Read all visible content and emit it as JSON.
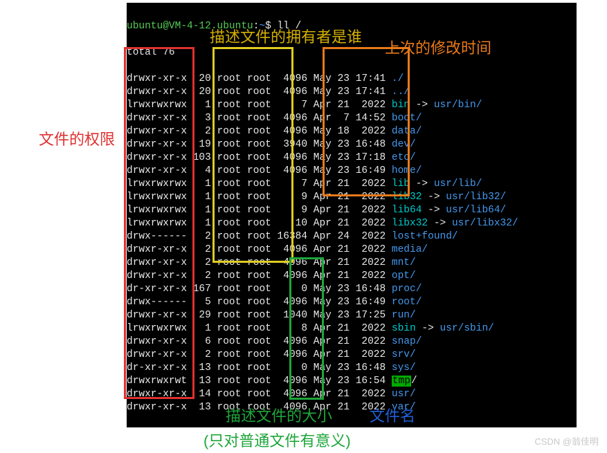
{
  "prompt": {
    "user": "ubuntu@VM-4-12.ubuntu",
    "sep": ":",
    "path": "~",
    "dollar": "$",
    "cmd": "ll /"
  },
  "total_line": "total 76",
  "rows": [
    {
      "perm": "drwxr-xr-x",
      "links": "20",
      "owner": "root",
      "group": "root",
      "size": "4096",
      "date": "May 23 17:41",
      "name": "./",
      "type": "dir"
    },
    {
      "perm": "drwxr-xr-x",
      "links": "20",
      "owner": "root",
      "group": "root",
      "size": "4096",
      "date": "May 23 17:41",
      "name": "../",
      "type": "dir"
    },
    {
      "perm": "lrwxrwxrwx",
      "links": "1",
      "owner": "root",
      "group": "root",
      "size": "7",
      "date": "Apr 21  2022",
      "name": "bin",
      "type": "link",
      "arrow": " -> ",
      "target": "usr/bin/"
    },
    {
      "perm": "drwxr-xr-x",
      "links": "3",
      "owner": "root",
      "group": "root",
      "size": "4096",
      "date": "Apr  7 14:52",
      "name": "boot/",
      "type": "dir"
    },
    {
      "perm": "drwxr-xr-x",
      "links": "2",
      "owner": "root",
      "group": "root",
      "size": "4096",
      "date": "May 18  2022",
      "name": "data/",
      "type": "dir"
    },
    {
      "perm": "drwxr-xr-x",
      "links": "19",
      "owner": "root",
      "group": "root",
      "size": "3940",
      "date": "May 23 16:48",
      "name": "dev/",
      "type": "dir"
    },
    {
      "perm": "drwxr-xr-x",
      "links": "103",
      "owner": "root",
      "group": "root",
      "size": "4096",
      "date": "May 23 17:18",
      "name": "etc/",
      "type": "dir"
    },
    {
      "perm": "drwxr-xr-x",
      "links": "4",
      "owner": "root",
      "group": "root",
      "size": "4096",
      "date": "May 23 16:49",
      "name": "home/",
      "type": "dir"
    },
    {
      "perm": "lrwxrwxrwx",
      "links": "1",
      "owner": "root",
      "group": "root",
      "size": "7",
      "date": "Apr 21  2022",
      "name": "lib",
      "type": "link",
      "arrow": " -> ",
      "target": "usr/lib/"
    },
    {
      "perm": "lrwxrwxrwx",
      "links": "1",
      "owner": "root",
      "group": "root",
      "size": "9",
      "date": "Apr 21  2022",
      "name": "lib32",
      "type": "link",
      "arrow": " -> ",
      "target": "usr/lib32/"
    },
    {
      "perm": "lrwxrwxrwx",
      "links": "1",
      "owner": "root",
      "group": "root",
      "size": "9",
      "date": "Apr 21  2022",
      "name": "lib64",
      "type": "link",
      "arrow": " -> ",
      "target": "usr/lib64/"
    },
    {
      "perm": "lrwxrwxrwx",
      "links": "1",
      "owner": "root",
      "group": "root",
      "size": "10",
      "date": "Apr 21  2022",
      "name": "libx32",
      "type": "link",
      "arrow": " -> ",
      "target": "usr/libx32/"
    },
    {
      "perm": "drwx------",
      "links": "2",
      "owner": "root",
      "group": "root",
      "size": "16384",
      "date": "Apr 24  2022",
      "name": "lost+found/",
      "type": "dir"
    },
    {
      "perm": "drwxr-xr-x",
      "links": "2",
      "owner": "root",
      "group": "root",
      "size": "4096",
      "date": "Apr 21  2022",
      "name": "media/",
      "type": "dir"
    },
    {
      "perm": "drwxr-xr-x",
      "links": "2",
      "owner": "root",
      "group": "root",
      "size": "4096",
      "date": "Apr 21  2022",
      "name": "mnt/",
      "type": "dir"
    },
    {
      "perm": "drwxr-xr-x",
      "links": "2",
      "owner": "root",
      "group": "root",
      "size": "4096",
      "date": "Apr 21  2022",
      "name": "opt/",
      "type": "dir"
    },
    {
      "perm": "dr-xr-xr-x",
      "links": "167",
      "owner": "root",
      "group": "root",
      "size": "0",
      "date": "May 23 16:48",
      "name": "proc/",
      "type": "dir"
    },
    {
      "perm": "drwx------",
      "links": "5",
      "owner": "root",
      "group": "root",
      "size": "4096",
      "date": "May 23 16:49",
      "name": "root/",
      "type": "dir"
    },
    {
      "perm": "drwxr-xr-x",
      "links": "29",
      "owner": "root",
      "group": "root",
      "size": "1040",
      "date": "May 23 17:25",
      "name": "run/",
      "type": "dir"
    },
    {
      "perm": "lrwxrwxrwx",
      "links": "1",
      "owner": "root",
      "group": "root",
      "size": "8",
      "date": "Apr 21  2022",
      "name": "sbin",
      "type": "link",
      "arrow": " -> ",
      "target": "usr/sbin/"
    },
    {
      "perm": "drwxr-xr-x",
      "links": "6",
      "owner": "root",
      "group": "root",
      "size": "4096",
      "date": "Apr 21  2022",
      "name": "snap/",
      "type": "dir"
    },
    {
      "perm": "drwxr-xr-x",
      "links": "2",
      "owner": "root",
      "group": "root",
      "size": "4096",
      "date": "Apr 21  2022",
      "name": "srv/",
      "type": "dir"
    },
    {
      "perm": "dr-xr-xr-x",
      "links": "13",
      "owner": "root",
      "group": "root",
      "size": "0",
      "date": "May 23 16:48",
      "name": "sys/",
      "type": "dir"
    },
    {
      "perm": "drwxrwxrwt",
      "links": "13",
      "owner": "root",
      "group": "root",
      "size": "4096",
      "date": "May 23 16:54",
      "name": "tmp",
      "type": "tmp",
      "tail": "/"
    },
    {
      "perm": "drwxr-xr-x",
      "links": "14",
      "owner": "root",
      "group": "root",
      "size": "4096",
      "date": "Apr 21  2022",
      "name": "usr/",
      "type": "dir"
    },
    {
      "perm": "drwxr-xr-x",
      "links": "13",
      "owner": "root",
      "group": "root",
      "size": "4096",
      "date": "Apr 21  2022",
      "name": "var/",
      "type": "dir"
    }
  ],
  "annotations": {
    "permission": "文件的权限",
    "owner": "描述文件的拥有者是谁",
    "mtime": "上次的修改时间",
    "size": "描述文件的大小",
    "size_note": "(只对普通文件有意义)",
    "filename": "文件名",
    "csdn": "CSDN @翁佳明"
  }
}
